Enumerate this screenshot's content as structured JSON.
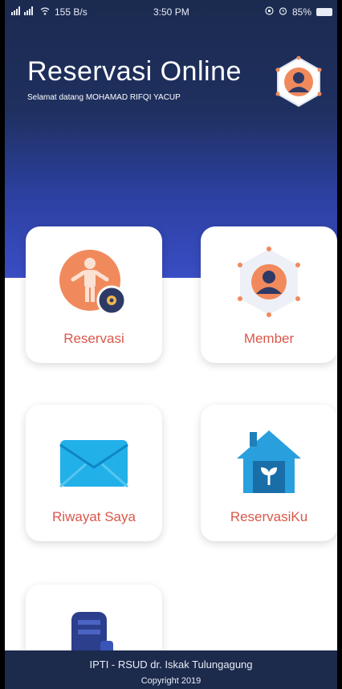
{
  "status_bar": {
    "signal": "📶📶",
    "speed": "155 B/s",
    "time": "3:50 PM",
    "battery": "85%"
  },
  "header": {
    "title": "Reservasi Online",
    "welcome": "Selamat datang MOHAMAD RIFQI YACUP",
    "profile_icon": "user-avatar-icon"
  },
  "menu": [
    {
      "label": "Reservasi",
      "icon": "person-gear-icon"
    },
    {
      "label": "Member",
      "icon": "member-network-icon"
    },
    {
      "label": "Riwayat Saya",
      "icon": "envelope-icon"
    },
    {
      "label": "ReservasiKu",
      "icon": "house-plant-icon"
    },
    {
      "label": "",
      "icon": "partial-icon"
    }
  ],
  "footer": {
    "line1": "IPTI - RSUD dr. Iskak Tulungagung",
    "line2": "Copyright  2019"
  },
  "colors": {
    "header_dark": "#1b2a4f",
    "header_light": "#3a4dc4",
    "accent_red": "#d9584a",
    "footer_bg": "#1c2a4c"
  }
}
